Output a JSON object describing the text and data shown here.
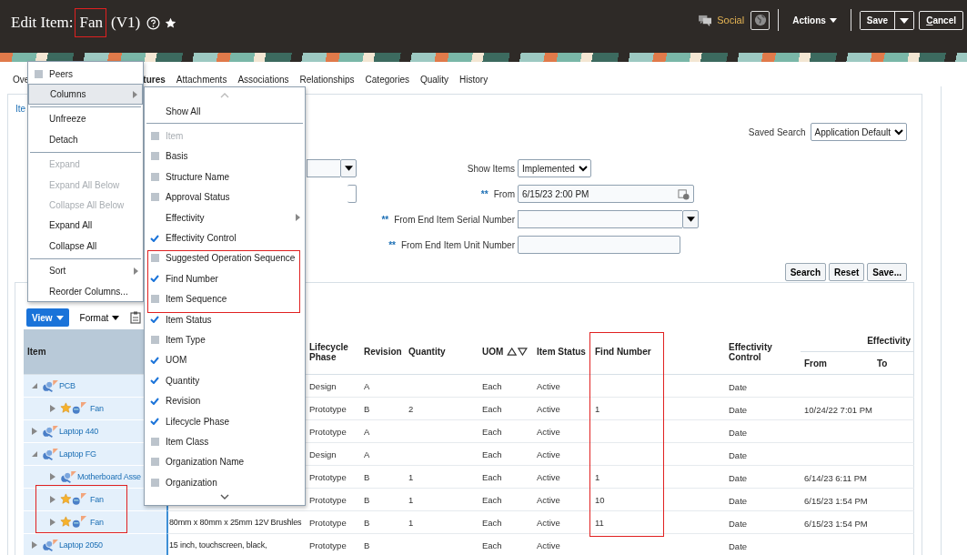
{
  "header": {
    "title_prefix": "Edit Item:",
    "title_name": "Fan",
    "title_version": "(V1)",
    "social_label": "Social",
    "actions_label": "Actions",
    "save_label": "Save",
    "cancel_label": "Cancel"
  },
  "tabs": [
    {
      "label": "Ove",
      "selected": false
    },
    {
      "label": "tures",
      "selected": true
    },
    {
      "label": "Attachments",
      "selected": false
    },
    {
      "label": "Associations",
      "selected": false
    },
    {
      "label": "Relationships",
      "selected": false
    },
    {
      "label": "Categories",
      "selected": false
    },
    {
      "label": "Quality",
      "selected": false
    },
    {
      "label": "History",
      "selected": false
    }
  ],
  "panel": {
    "link": "Ite"
  },
  "search": {
    "saved_search_label": "Saved Search",
    "saved_search_value": "Application Default",
    "show_items_label": "Show Items",
    "show_items_value": "Implemented",
    "fields": [
      {
        "required": "**",
        "label": "From",
        "value": "6/15/23 2:00 PM",
        "kind": "date"
      },
      {
        "required": "**",
        "label": "From End Item Serial Number",
        "kind": "combo"
      },
      {
        "required": "**",
        "label": "From End Item Unit Number",
        "kind": "text"
      }
    ],
    "buttons": [
      "Search",
      "Reset",
      "Save..."
    ]
  },
  "toolbar": {
    "view_label": "View",
    "format_label": "Format"
  },
  "table": {
    "columns": [
      {
        "label": "Item",
        "sortable": false
      },
      {
        "label": "Lifecycle Phase",
        "sortable": false
      },
      {
        "label": "Revision",
        "sortable": false
      },
      {
        "label": "Quantity",
        "sortable": false
      },
      {
        "label": "UOM",
        "sortable": true
      },
      {
        "label": "Item Status",
        "sortable": false
      },
      {
        "label": "Find Number",
        "sortable": false
      },
      {
        "label": "Effectivity Control",
        "sortable": false
      }
    ],
    "effectivity_group": {
      "label": "Effectivity",
      "from_label": "From",
      "to_label": "To"
    },
    "rows": [
      {
        "name": "PCB",
        "kind": "assembly",
        "expanded": true,
        "lifecycle_phase": "Design",
        "revision": "A",
        "uom": "Each",
        "status": "Active",
        "effectivity_control": "Date",
        "children": [
          {
            "name": "Fan",
            "kind": "component",
            "expanded": false,
            "lifecycle_phase": "Prototype",
            "revision": "B",
            "quantity": "2",
            "uom": "Each",
            "status": "Active",
            "find_number": "1",
            "effectivity_control": "Date",
            "from": "10/24/22 7:01 PM"
          }
        ]
      },
      {
        "name": "Laptop 440",
        "kind": "assembly",
        "expanded": false,
        "lifecycle_phase": "Prototype",
        "revision": "A",
        "uom": "Each",
        "status": "Active",
        "effectivity_control": "Date"
      },
      {
        "name": "Laptop FG",
        "kind": "assembly",
        "expanded": true,
        "lifecycle_phase": "Design",
        "revision": "A",
        "uom": "Each",
        "status": "Active",
        "effectivity_control": "Date",
        "children": [
          {
            "name": "Motherboard Asse",
            "kind": "assembly",
            "expanded": false,
            "lifecycle_phase": "Prototype",
            "revision": "B",
            "quantity": "1",
            "uom": "Each",
            "status": "Active",
            "find_number": "1",
            "effectivity_control": "Date",
            "from": "6/14/23 6:11 PM"
          },
          {
            "name": "Fan",
            "kind": "component",
            "expanded": false,
            "lifecycle_phase": "Prototype",
            "revision": "B",
            "quantity": "1",
            "uom": "Each",
            "status": "Active",
            "find_number": "10",
            "effectivity_control": "Date",
            "from": "6/15/23 1:54 PM"
          },
          {
            "name": "Fan",
            "kind": "component",
            "expanded": false,
            "description": "80mm x 80mm x 25mm 12V Brushles",
            "lifecycle_phase": "Prototype",
            "revision": "B",
            "quantity": "1",
            "uom": "Each",
            "status": "Active",
            "find_number": "11",
            "effectivity_control": "Date",
            "from": "6/15/23 1:54 PM"
          }
        ]
      },
      {
        "name": "Laptop 2050",
        "kind": "assembly",
        "expanded": false,
        "description": "15 inch, touchscreen, black,",
        "lifecycle_phase": "Prototype",
        "revision": "B",
        "uom": "Each",
        "status": "Active",
        "effectivity_control": "Date"
      }
    ]
  },
  "context_menu": {
    "items": [
      {
        "kind": "check",
        "label": "Peers",
        "checked": false,
        "selected": false,
        "disabled": false
      },
      {
        "kind": "submenu",
        "label": "Columns",
        "selected": true,
        "disabled": false
      },
      {
        "kind": "separator"
      },
      {
        "kind": "plain",
        "label": "Unfreeze",
        "selected": false,
        "disabled": false
      },
      {
        "kind": "plain",
        "label": "Detach",
        "selected": false,
        "disabled": false
      },
      {
        "kind": "separator"
      },
      {
        "kind": "plain",
        "label": "Expand",
        "selected": false,
        "disabled": true
      },
      {
        "kind": "plain",
        "label": "Expand All Below",
        "selected": false,
        "disabled": true
      },
      {
        "kind": "plain",
        "label": "Collapse All Below",
        "selected": false,
        "disabled": true
      },
      {
        "kind": "plain",
        "label": "Expand All",
        "selected": false,
        "disabled": false
      },
      {
        "kind": "plain",
        "label": "Collapse All",
        "selected": false,
        "disabled": false
      },
      {
        "kind": "separator"
      },
      {
        "kind": "submenu",
        "label": "Sort",
        "selected": false,
        "disabled": false
      },
      {
        "kind": "plain",
        "label": "Reorder Columns...",
        "selected": false,
        "disabled": false
      }
    ]
  },
  "columns_menu": {
    "items": [
      {
        "kind": "plain",
        "label": "Show All",
        "selected": false,
        "disabled": false
      },
      {
        "kind": "separator"
      },
      {
        "kind": "check",
        "label": "Item",
        "checked": false,
        "selected": false,
        "disabled": true
      },
      {
        "kind": "check",
        "label": "Basis",
        "checked": false,
        "selected": false,
        "disabled": false
      },
      {
        "kind": "check",
        "label": "Structure Name",
        "checked": false,
        "selected": false,
        "disabled": false
      },
      {
        "kind": "check",
        "label": "Approval Status",
        "checked": false,
        "selected": false,
        "disabled": false
      },
      {
        "kind": "submenu",
        "label": "Effectivity",
        "selected": false,
        "disabled": false
      },
      {
        "kind": "check",
        "label": "Effectivity Control",
        "checked": true,
        "selected": false,
        "disabled": false
      },
      {
        "kind": "check",
        "label": "Suggested Operation Sequence",
        "checked": false,
        "selected": false,
        "disabled": false
      },
      {
        "kind": "check",
        "label": "Find Number",
        "checked": true,
        "selected": false,
        "disabled": false
      },
      {
        "kind": "check",
        "label": "Item Sequence",
        "checked": false,
        "selected": false,
        "disabled": false
      },
      {
        "kind": "check",
        "label": "Item Status",
        "checked": true,
        "selected": false,
        "disabled": false
      },
      {
        "kind": "check",
        "label": "Item Type",
        "checked": false,
        "selected": false,
        "disabled": false
      },
      {
        "kind": "check",
        "label": "UOM",
        "checked": true,
        "selected": false,
        "disabled": false
      },
      {
        "kind": "check",
        "label": "Quantity",
        "checked": true,
        "selected": false,
        "disabled": false
      },
      {
        "kind": "check",
        "label": "Revision",
        "checked": true,
        "selected": false,
        "disabled": false
      },
      {
        "kind": "check",
        "label": "Lifecycle Phase",
        "checked": true,
        "selected": false,
        "disabled": false
      },
      {
        "kind": "check",
        "label": "Item Class",
        "checked": false,
        "selected": false,
        "disabled": false
      },
      {
        "kind": "check",
        "label": "Organization Name",
        "checked": false,
        "selected": false,
        "disabled": false
      },
      {
        "kind": "check",
        "label": "Organization",
        "checked": false,
        "selected": false,
        "disabled": false
      }
    ]
  }
}
